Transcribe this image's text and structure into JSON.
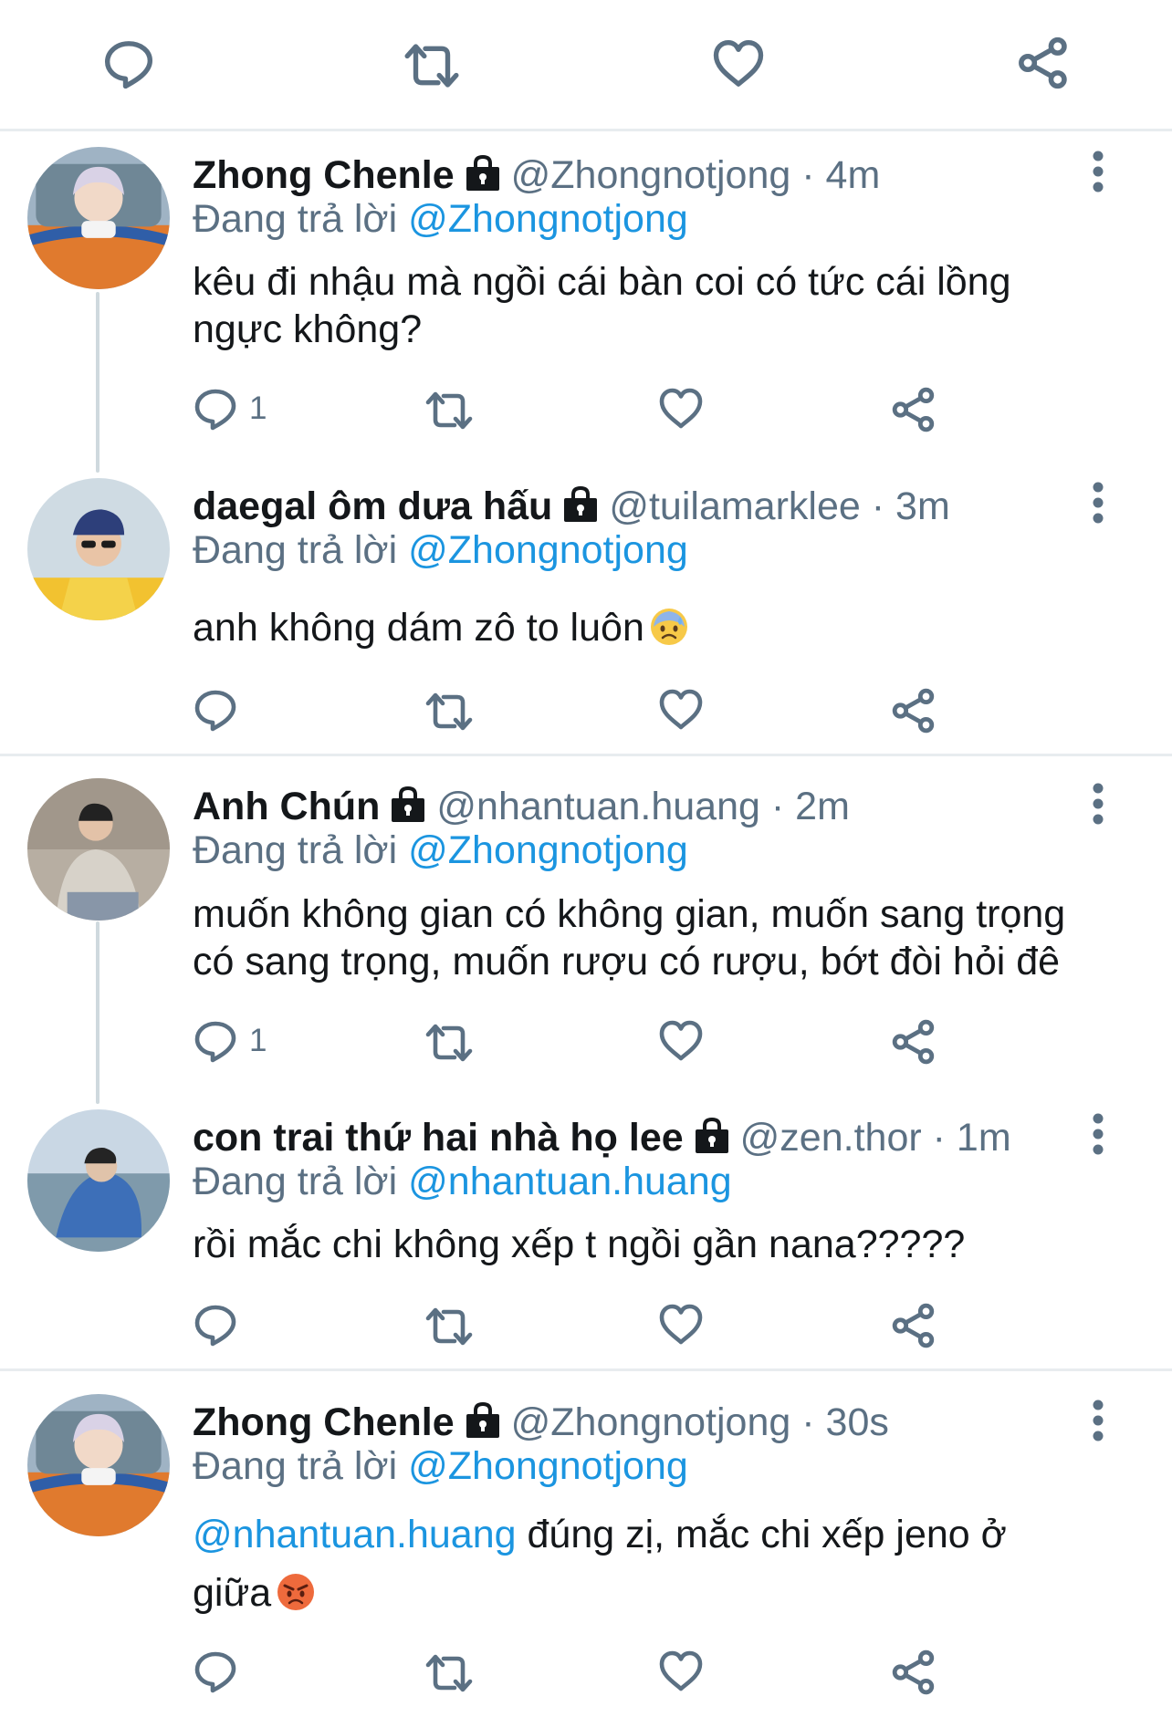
{
  "colors": {
    "icon_gray": "#5b7083",
    "mention_blue": "#1b95e0",
    "name_black": "#14171a",
    "divider": "#e8ecef"
  },
  "top_actions": [
    "reply-icon",
    "retweet-icon",
    "like-icon",
    "share-icon"
  ],
  "tweets": [
    {
      "name": "Zhong Chenle",
      "handle": "@Zhongnotjong",
      "time": "4m",
      "dot": "·",
      "reply_prefix": "Đang trả lời",
      "reply_to": "@Zhongnotjong",
      "text": "kêu đi nhậu mà ngồi cái bàn coi có tức cái lồng ngực không?",
      "reply_count": "1"
    },
    {
      "name": "daegal ôm dưa hấu",
      "handle": "@tuilamarklee",
      "time": "3m",
      "dot": "·",
      "reply_prefix": "Đang trả lời",
      "reply_to": "@Zhongnotjong",
      "text": "anh không dám zô to luôn",
      "emoji": "sad-sweat-emoji"
    },
    {
      "name": "Anh Chún",
      "handle": "@nhantuan.huang",
      "time": "2m",
      "dot": "·",
      "reply_prefix": "Đang trả lời",
      "reply_to": "@Zhongnotjong",
      "text": "muốn không gian có không gian, muốn sang trọng có sang trọng, muốn rượu có rượu, bớt đòi hỏi đê",
      "reply_count": "1"
    },
    {
      "name": "con trai thứ hai nhà họ lee",
      "handle": "@zen.thor",
      "time": "1m",
      "dot": "·",
      "reply_prefix": "Đang trả lời",
      "reply_to": "@nhantuan.huang",
      "text": "rồi mắc chi không xếp t ngồi gần nana?????"
    },
    {
      "name": "Zhong Chenle",
      "handle": "@Zhongnotjong",
      "time": "30s",
      "dot": "·",
      "reply_prefix": "Đang trả lời",
      "reply_to": "@Zhongnotjong",
      "text_mention": "@nhantuan.huang",
      "text_line1": "đúng zị, mắc chi xếp jeno ở",
      "text_line2": "giữa",
      "emoji": "angry-face-emoji"
    }
  ]
}
